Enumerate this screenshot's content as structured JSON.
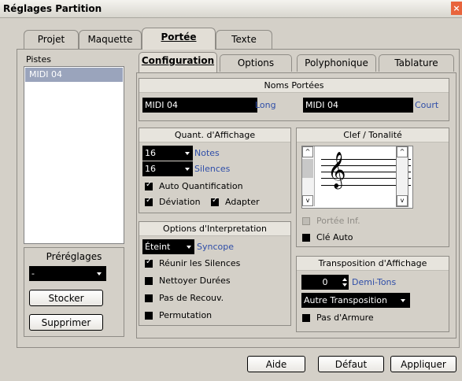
{
  "window": {
    "title": "Réglages Partition",
    "close_glyph": "×"
  },
  "main_tabs": [
    "Projet",
    "Maquette",
    "Portée",
    "Texte"
  ],
  "pistes": {
    "label": "Pistes",
    "items": [
      "MIDI 04"
    ]
  },
  "presets": {
    "label": "Préréglages",
    "value": "-",
    "store": "Stocker",
    "delete": "Supprimer"
  },
  "sub_tabs": [
    "Configuration",
    "Options",
    "Polyphonique",
    "Tablature"
  ],
  "noms": {
    "title": "Noms Portées",
    "long_value": "MIDI 04",
    "long_label": "Long",
    "short_value": "MIDI 04",
    "short_label": "Court"
  },
  "quant": {
    "title": "Quant. d'Affichage",
    "notes_value": "16",
    "notes_label": "Notes",
    "silences_value": "16",
    "silences_label": "Silences",
    "auto": "Auto Quantification",
    "deviation": "Déviation",
    "adapter": "Adapter"
  },
  "interp": {
    "title": "Options d'Interpretation",
    "syncope_value": "Éteint",
    "syncope_label": "Syncope",
    "reunir": "Réunir les Silences",
    "nettoyer": "Nettoyer Durées",
    "recouv": "Pas de Recouv.",
    "permutation": "Permutation"
  },
  "clef": {
    "title": "Clef / Tonalité",
    "portee_inf": "Portée Inf.",
    "cle_auto": "Clé Auto",
    "clef_glyph": "𝄞"
  },
  "transpo": {
    "title": "Transposition d'Affichage",
    "value": "0",
    "unit": "Demi-Tons",
    "autre": "Autre Transposition",
    "pas_armure": "Pas d'Armure"
  },
  "footer": {
    "aide": "Aide",
    "defaut": "Défaut",
    "appliquer": "Appliquer"
  },
  "states": {
    "auto": true,
    "deviation": true,
    "adapter": true,
    "reunir": true,
    "nettoyer": false,
    "recouv": false,
    "permutation": false,
    "portee_inf": false,
    "cle_auto": false,
    "pas_armure": false
  },
  "colors": {
    "selection": "#9aa4bc",
    "label_blue": "#2f4ea8",
    "close_red": "#e8643c"
  }
}
